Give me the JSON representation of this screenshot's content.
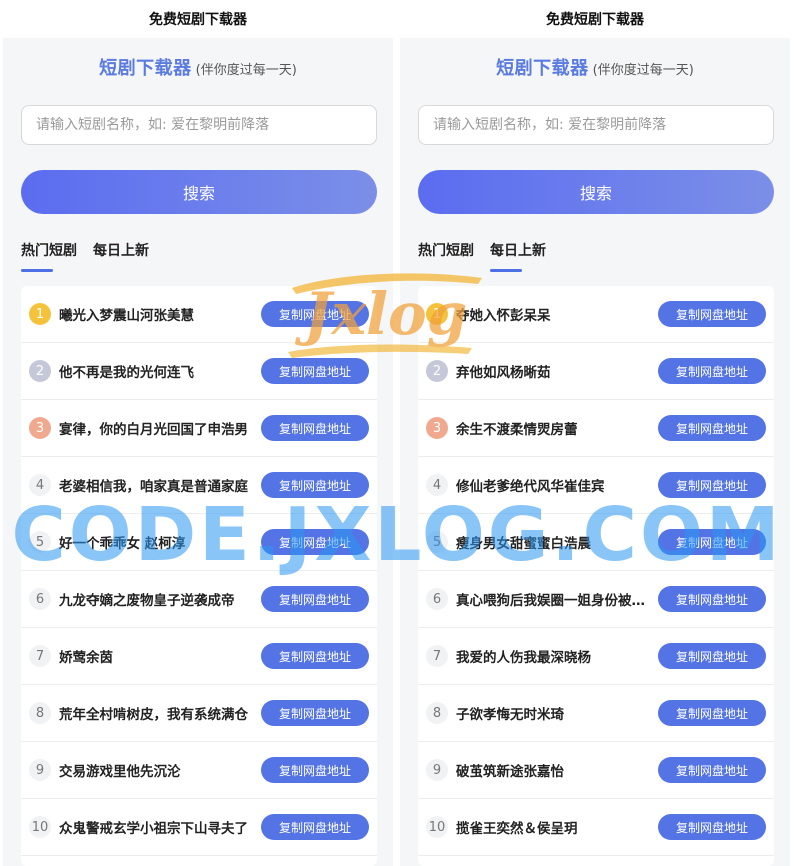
{
  "screens": [
    {
      "topbar_title": "免费短剧下载器",
      "brand_main": "短剧下载器",
      "brand_sub": "(伴你度过每一天)",
      "search_placeholder": "请输入短剧名称，如: 爱在黎明前降落",
      "search_button": "搜索",
      "tabs": [
        {
          "label": "热门短剧",
          "active": true
        },
        {
          "label": "每日上新",
          "active": false
        }
      ],
      "items": [
        {
          "rank": "1",
          "title": "曦光入梦震山河张美慧",
          "button": "复制网盘地址"
        },
        {
          "rank": "2",
          "title": "他不再是我的光何连飞",
          "button": "复制网盘地址"
        },
        {
          "rank": "3",
          "title": "宴律，你的白月光回国了申浩男",
          "button": "复制网盘地址"
        },
        {
          "rank": "4",
          "title": "老婆相信我，咱家真是普通家庭",
          "button": "复制网盘地址"
        },
        {
          "rank": "5",
          "title": "好一个乖乖女 赵柯淳",
          "button": "复制网盘地址"
        },
        {
          "rank": "6",
          "title": "九龙夺嫡之废物皇子逆袭成帝",
          "button": "复制网盘地址"
        },
        {
          "rank": "7",
          "title": "娇莺余茵",
          "button": "复制网盘地址"
        },
        {
          "rank": "8",
          "title": "荒年全村啃树皮，我有系统满仓",
          "button": "复制网盘地址"
        },
        {
          "rank": "9",
          "title": "交易游戏里他先沉沦",
          "button": "复制网盘地址"
        },
        {
          "rank": "10",
          "title": "众鬼警戒玄学小祖宗下山寻夫了",
          "button": "复制网盘地址"
        }
      ]
    },
    {
      "topbar_title": "免费短剧下载器",
      "brand_main": "短剧下载器",
      "brand_sub": "(伴你度过每一天)",
      "search_placeholder": "请输入短剧名称，如: 爱在黎明前降落",
      "search_button": "搜索",
      "tabs": [
        {
          "label": "热门短剧",
          "active": false
        },
        {
          "label": "每日上新",
          "active": true
        }
      ],
      "items": [
        {
          "rank": "1",
          "title": "夺她入怀彭呆呆",
          "button": "复制网盘地址"
        },
        {
          "rank": "2",
          "title": "弃他如风杨晰茹",
          "button": "复制网盘地址"
        },
        {
          "rank": "3",
          "title": "余生不渡柔情焸房蕾",
          "button": "复制网盘地址"
        },
        {
          "rank": "4",
          "title": "修仙老爹绝代风华崔佳宾",
          "button": "复制网盘地址"
        },
        {
          "rank": "5",
          "title": "瘦身男女甜蜜蜜白浩晨",
          "button": "复制网盘地址"
        },
        {
          "rank": "6",
          "title": "真心喂狗后我娱圈一姐身份被曝光",
          "button": "复制网盘地址"
        },
        {
          "rank": "7",
          "title": "我爱的人伤我最深晓杨",
          "button": "复制网盘地址"
        },
        {
          "rank": "8",
          "title": "子欲孝悔无时米琦",
          "button": "复制网盘地址"
        },
        {
          "rank": "9",
          "title": "破茧筑新途张嘉怡",
          "button": "复制网盘地址"
        },
        {
          "rank": "10",
          "title": "揽雀王奕然＆侯呈玥",
          "button": "复制网盘地址"
        }
      ]
    }
  ],
  "watermark": {
    "logo_text": "Jxlog",
    "text": "CODE.JXLOG.COM"
  },
  "colors": {
    "brand": "#5a7be0",
    "button": "#5474e6",
    "rank1": "#f5c33b",
    "rank2": "#c4c8d8",
    "rank3": "#f0a98e",
    "watermark": "#2896f0"
  }
}
